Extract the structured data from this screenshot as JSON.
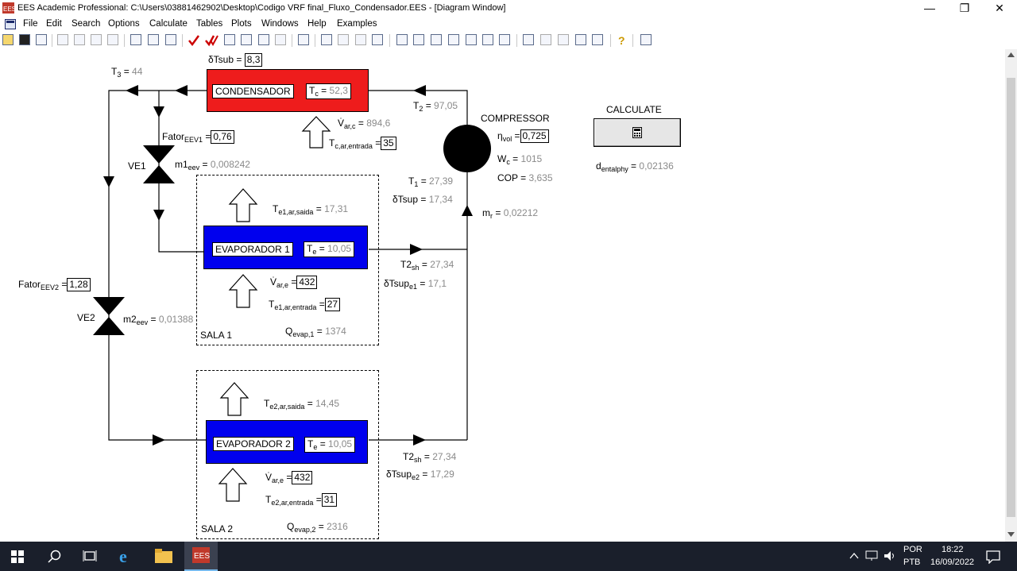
{
  "window": {
    "title": "EES Academic Professional:  C:\\Users\\03881462902\\Desktop\\Codigo VRF final_Fluxo_Condensador.EES - [Diagram Window]",
    "icon_text": "EES",
    "minimize": "—",
    "restore": "❐",
    "close": "✕"
  },
  "menu": [
    "File",
    "Edit",
    "Search",
    "Options",
    "Calculate",
    "Tables",
    "Plots",
    "Windows",
    "Help",
    "Examples"
  ],
  "mdi_controls": [
    "_",
    "▫",
    "×"
  ],
  "diagram": {
    "condensador": {
      "label": "CONDENSADOR",
      "tc_name": "T",
      "tc_sub": "c",
      "tc_val": "52,3"
    },
    "dtsub": {
      "name": "δTsub",
      "value": "8,3"
    },
    "t3": {
      "name": "T",
      "sub": "3",
      "value": "44"
    },
    "t2": {
      "name": "T",
      "sub": "2",
      "value": "97,05"
    },
    "var_c": {
      "name": "V̇",
      "sub": "ar,c",
      "value": "894,6"
    },
    "tc_entrada": {
      "name": "T",
      "sub": "c,ar,entrada",
      "value": "35"
    },
    "compressor": {
      "label": "COMPRESSOR"
    },
    "eta_vol": {
      "name": "η",
      "sub": "vol",
      "value": "0,725"
    },
    "wc": {
      "name": "W",
      "sub": "c",
      "value": "1015"
    },
    "cop": {
      "name": "COP",
      "value": "3,635"
    },
    "t1": {
      "name": "T",
      "sub": "1",
      "value": "27,39"
    },
    "dtsup": {
      "name": "δTsup",
      "value": "17,34"
    },
    "mr": {
      "name": "m",
      "sub": "r",
      "value": "0,02212"
    },
    "calculate": {
      "label": "CALCULATE",
      "icon": "calculator-icon"
    },
    "d_entalphy": {
      "name": "d",
      "sub": "entalphy",
      "value": "0,02136"
    },
    "fator_eev1": {
      "name": "Fator",
      "sub": "EEV1",
      "value": "0,76"
    },
    "ve1": {
      "label": "VE1"
    },
    "m1eev": {
      "name": "m1",
      "sub": "eev",
      "value": "0,008242"
    },
    "te1_saida": {
      "name": "T",
      "sub": "e1,ar,saida",
      "value": "17,31"
    },
    "evap1": {
      "label": "EVAPORADOR 1",
      "te_name": "T",
      "te_sub": "e",
      "te_val": "10,05"
    },
    "t2sh_1": {
      "name": "T2",
      "sub": "sh",
      "value": "27,34"
    },
    "dtsup_e1": {
      "name": "δTsup",
      "sub": "e1",
      "value": "17,1"
    },
    "var_e1": {
      "name": "V̇",
      "sub": "ar,e",
      "value": "432"
    },
    "te1_entrada": {
      "name": "T",
      "sub": "e1,ar,entrada",
      "value": "27"
    },
    "sala1": {
      "label": "SALA 1"
    },
    "qevap1": {
      "name": "Q",
      "sub": "evap,1",
      "value": "1374"
    },
    "fator_eev2": {
      "name": "Fator",
      "sub": "EEV2",
      "value": "1,28"
    },
    "ve2": {
      "label": "VE2"
    },
    "m2eev": {
      "name": "m2",
      "sub": "eev",
      "value": "0,01388"
    },
    "te2_saida": {
      "name": "T",
      "sub": "e2,ar,saida",
      "value": "14,45"
    },
    "evap2": {
      "label": "EVAPORADOR 2",
      "te_name": "T",
      "te_sub": "e",
      "te_val": "10,05"
    },
    "t2sh_2": {
      "name": "T2",
      "sub": "sh",
      "value": "27,34"
    },
    "dtsup_e2": {
      "name": "δTsup",
      "sub": "e2",
      "value": "17,29"
    },
    "var_e2": {
      "name": "V̇",
      "sub": "ar,e",
      "value": "432"
    },
    "te2_entrada": {
      "name": "T",
      "sub": "e2,ar,entrada",
      "value": "31"
    },
    "sala2": {
      "label": "SALA 2"
    },
    "qevap2": {
      "name": "Q",
      "sub": "evap,2",
      "value": "2316"
    }
  },
  "colors": {
    "condensador": "#ee1c1c",
    "evaporador": "#0000ee",
    "taskbar": "#1a1f2b"
  },
  "taskbar": {
    "lang1": "POR",
    "lang2": "PTB",
    "time": "18:22",
    "date": "16/09/2022",
    "app_icon_text": "EES"
  }
}
